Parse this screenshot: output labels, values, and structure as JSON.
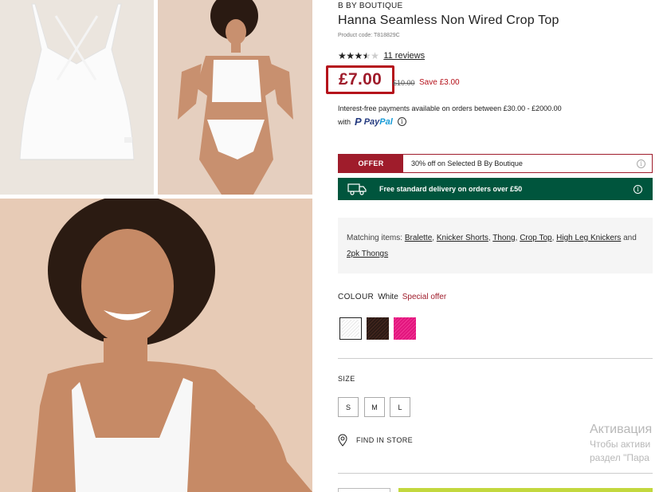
{
  "product": {
    "brand": "B BY BOUTIQUE",
    "title": "Hanna Seamless Non Wired Crop Top",
    "code": "Product code: T818829C",
    "rating": 3.5,
    "reviews": "11 reviews",
    "price": "£7.00",
    "old_price": "£10.00",
    "save": "Save £3.00"
  },
  "payment": {
    "interest": "Interest-free payments available on orders between £30.00 - £2000.00",
    "with": "with",
    "paypal_p": "P",
    "paypal_pay": "Pay",
    "paypal_pal": "Pal",
    "info": "i"
  },
  "offer": {
    "tag": "OFFER",
    "text": "30% off on Selected B By Boutique"
  },
  "delivery": {
    "text": "Free standard delivery on orders over £50"
  },
  "matching": {
    "label": "Matching items:",
    "items": [
      "Bralette",
      "Knicker Shorts",
      "Thong",
      "Crop Top",
      "High Leg Knickers",
      "2pk Thongs"
    ],
    "and": "and"
  },
  "colour": {
    "label": "COLOUR",
    "value": "White",
    "special": "Special offer",
    "swatches": [
      "white",
      "brown",
      "pink"
    ]
  },
  "size": {
    "label": "SIZE",
    "options": [
      "S",
      "M",
      "L"
    ]
  },
  "store": {
    "label": "FIND IN STORE"
  },
  "watermark": {
    "line1": "Активация",
    "line2": "Чтобы активи",
    "line3": "раздел \"Пара"
  },
  "colors": {
    "accent": "#9f1c2b",
    "delivery": "#00553d",
    "add_button": "#c3d83e"
  }
}
